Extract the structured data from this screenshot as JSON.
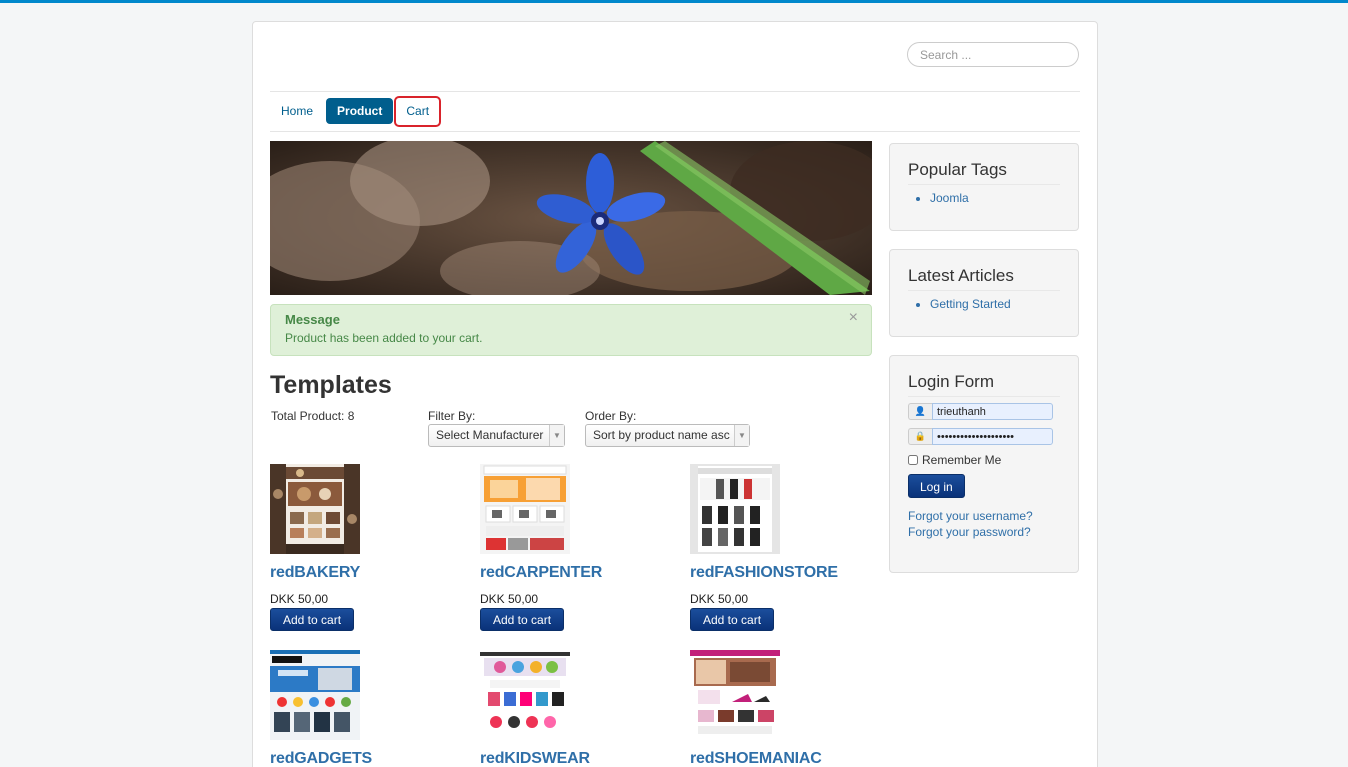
{
  "search": {
    "placeholder": "Search ..."
  },
  "nav": {
    "items": [
      {
        "label": "Home"
      },
      {
        "label": "Product"
      },
      {
        "label": "Cart"
      }
    ]
  },
  "message": {
    "title": "Message",
    "text": "Product has been added to your cart.",
    "close": "×"
  },
  "main": {
    "title": "Templates",
    "total": "Total Product: 8",
    "filter_label": "Filter By:",
    "filter_value": "Select Manufacturer",
    "order_label": "Order By:",
    "order_value": "Sort by product name asc"
  },
  "products": [
    {
      "name": "redBAKERY",
      "price": "DKK 50,00",
      "button": "Add to cart"
    },
    {
      "name": "redCARPENTER",
      "price": "DKK 50,00",
      "button": "Add to cart"
    },
    {
      "name": "redFASHIONSTORE",
      "price": "DKK 50,00",
      "button": "Add to cart"
    },
    {
      "name": "redGADGETS"
    },
    {
      "name": "redKIDSWEAR"
    },
    {
      "name": "redSHOEMANIAC"
    }
  ],
  "sidebar": {
    "popular_tags": {
      "title": "Popular Tags",
      "items": [
        "Joomla"
      ]
    },
    "latest_articles": {
      "title": "Latest Articles",
      "items": [
        "Getting Started"
      ]
    },
    "login": {
      "title": "Login Form",
      "username": "trieuthanh",
      "password": "••••••••••••••••••••",
      "remember_label": "Remember Me",
      "button": "Log in",
      "forgot_username": "Forgot your username?",
      "forgot_password": "Forgot your password?"
    }
  }
}
